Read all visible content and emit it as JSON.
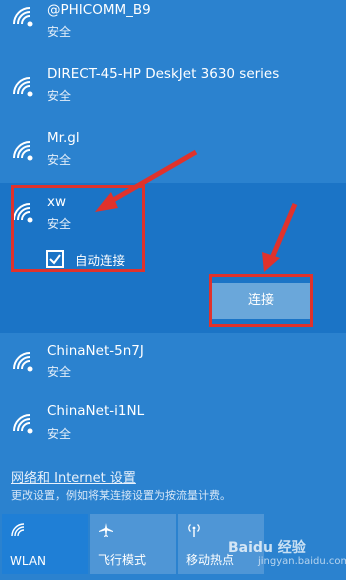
{
  "networks": [
    {
      "ssid": "@PHICOMM_B9",
      "security": "安全"
    },
    {
      "ssid": "DIRECT-45-HP DeskJet 3630 series",
      "security": "安全"
    },
    {
      "ssid": "Mr.gl",
      "security": "安全"
    },
    {
      "ssid": "xw",
      "security": "安全",
      "auto_connect_label": "自动连接",
      "auto_connect_checked": true,
      "connect_label": "连接"
    },
    {
      "ssid": "ChinaNet-5n7J",
      "security": "安全"
    },
    {
      "ssid": "ChinaNet-i1NL",
      "security": "安全"
    }
  ],
  "settings": {
    "link": "网络和 Internet 设置",
    "desc": "更改设置，例如将某连接设置为按流量计费。"
  },
  "quick_actions": [
    {
      "label": "WLAN",
      "icon": "wifi-icon",
      "active": true
    },
    {
      "label": "飞行模式",
      "icon": "airplane-icon",
      "active": false
    },
    {
      "label": "移动热点",
      "icon": "hotspot-icon",
      "active": false
    }
  ],
  "watermark": {
    "brand": "Baidu 经验",
    "url": "jingyan.baidu.com"
  },
  "colors": {
    "panel": "#2b82cf",
    "selected": "#1b74c6",
    "annotation": "#e0322c",
    "active_tile": "#1f7fd6"
  }
}
